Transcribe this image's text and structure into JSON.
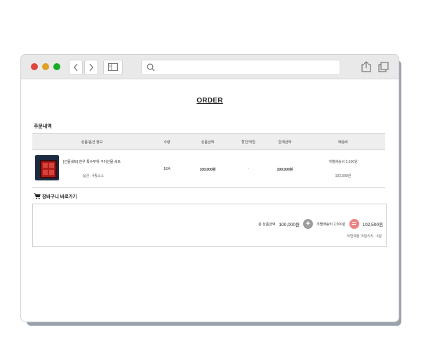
{
  "browser": {
    "address_placeholder": "",
    "back_label": "‹",
    "forward_label": "›"
  },
  "page": {
    "title": "ORDER"
  },
  "order_section": {
    "title": "주문내역",
    "columns": {
      "product": "상품/옵션 정보",
      "quantity": "수량",
      "price": "상품금액",
      "discount": "할인/적립",
      "total": "합계금액",
      "shipping": "배송비"
    },
    "items": [
      {
        "name": "[선물세트] 한우 특수부위 구이선물 세트",
        "option": "옵션 : 4종소스",
        "quantity": "1EA",
        "price": "100,000원",
        "discount": "-",
        "total": "100,000원",
        "shipping_type": "개별배송비 2,500원",
        "shipping_total": "102,500원"
      }
    ]
  },
  "cart_link": {
    "label": "장바구니 바로가기"
  },
  "summary": {
    "product_total_label": "총 상품금액",
    "product_total_value": "100,000원",
    "shipping_label": "개별배송비 2,500원",
    "grand_total": "102,500원",
    "mileage": "적립예정 마일리지 : 0원",
    "plus_symbol": "+",
    "equals_symbol": "="
  },
  "colors": {
    "plus_circle": "#9c9c9c",
    "equals_circle": "#ef8080",
    "table_header_bg": "#eeeeee"
  }
}
